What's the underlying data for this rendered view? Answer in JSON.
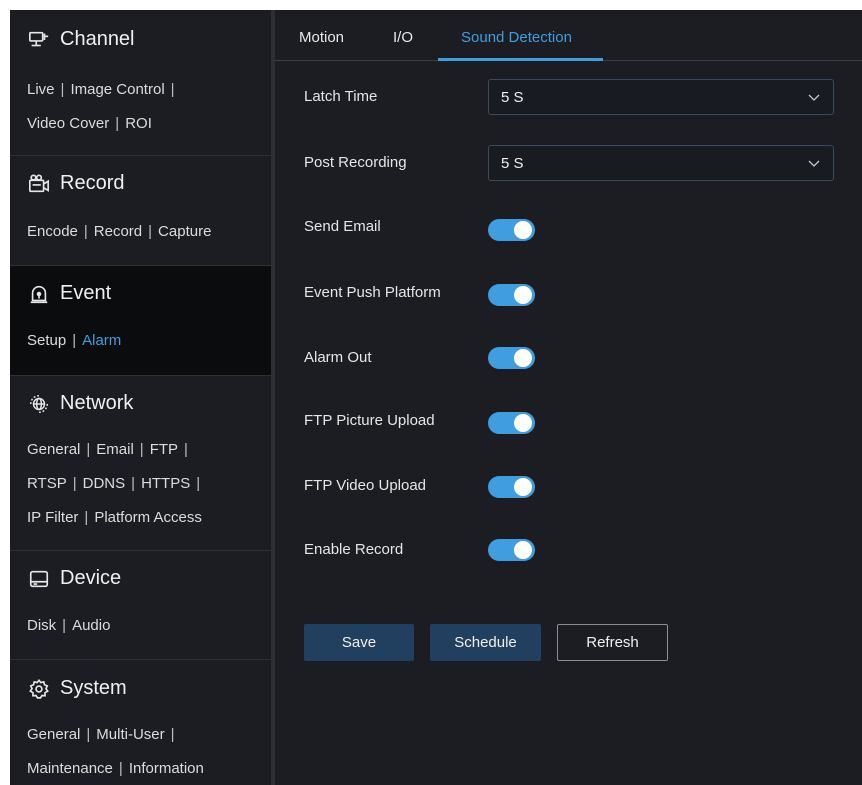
{
  "sidebar": {
    "sections": [
      {
        "title": "Channel",
        "icon": "monitor-icon",
        "links": [
          "Live",
          "Image Control",
          "Video Cover",
          "ROI"
        ]
      },
      {
        "title": "Record",
        "icon": "camera-record-icon",
        "links": [
          "Encode",
          "Record",
          "Capture"
        ]
      },
      {
        "title": "Event",
        "icon": "alarm-bell-icon",
        "links": [
          "Setup",
          "Alarm"
        ],
        "active_link": "Alarm"
      },
      {
        "title": "Network",
        "icon": "globe-icon",
        "links": [
          "General",
          "Email",
          "FTP",
          "RTSP",
          "DDNS",
          "HTTPS",
          "IP Filter",
          "Platform Access"
        ]
      },
      {
        "title": "Device",
        "icon": "hard-disk-icon",
        "links": [
          "Disk",
          "Audio"
        ]
      },
      {
        "title": "System",
        "icon": "gear-icon",
        "links": [
          "General",
          "Multi-User",
          "Maintenance",
          "Information"
        ]
      }
    ],
    "separator": "|"
  },
  "tabs": [
    {
      "label": "Motion"
    },
    {
      "label": "I/O"
    },
    {
      "label": "Sound Detection",
      "active": true
    }
  ],
  "form": {
    "latch_time": {
      "label": "Latch Time",
      "value": "5 S"
    },
    "post_recording": {
      "label": "Post Recording",
      "value": "5 S"
    },
    "toggles": [
      {
        "label": "Send Email",
        "on": true
      },
      {
        "label": "Event Push Platform",
        "on": true
      },
      {
        "label": "Alarm Out",
        "on": true
      },
      {
        "label": "FTP Picture Upload",
        "on": true
      },
      {
        "label": "FTP Video Upload",
        "on": true
      },
      {
        "label": "Enable Record",
        "on": true
      }
    ]
  },
  "buttons": {
    "save": "Save",
    "schedule": "Schedule",
    "refresh": "Refresh"
  },
  "colors": {
    "accent": "#3f9de0",
    "background": "#1b1d22",
    "active_section": "#0b0c0e",
    "button_fill": "#214060"
  }
}
